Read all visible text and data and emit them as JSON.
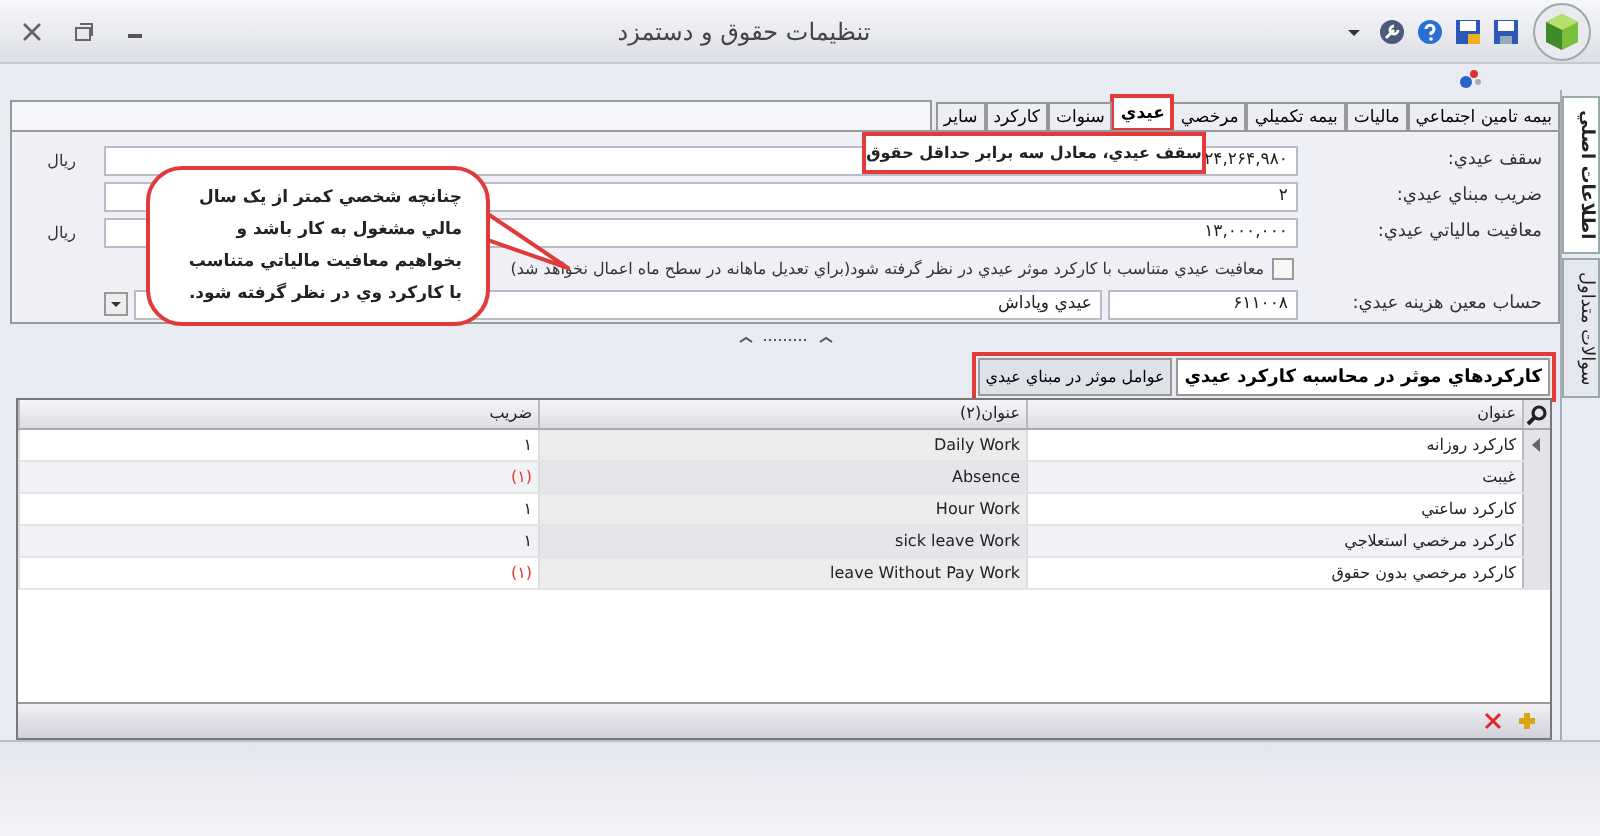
{
  "window": {
    "title": "تنظيمات حقوق و دستمزد"
  },
  "side_tabs": [
    {
      "label": "اطلاعات اصلي",
      "selected": true
    },
    {
      "label": "سوالات متداول",
      "selected": false
    }
  ],
  "tabs": [
    {
      "label": "بيمه تامين اجتماعي",
      "selected": false,
      "highlighted": false
    },
    {
      "label": "ماليات",
      "selected": false,
      "highlighted": false
    },
    {
      "label": "بيمه تكميلي",
      "selected": false,
      "highlighted": false
    },
    {
      "label": "مرخصي",
      "selected": false,
      "highlighted": false
    },
    {
      "label": "عيدي",
      "selected": true,
      "highlighted": true
    },
    {
      "label": "سنوات",
      "selected": false,
      "highlighted": false
    },
    {
      "label": "كاركرد",
      "selected": false,
      "highlighted": false
    },
    {
      "label": "ساير",
      "selected": false,
      "highlighted": false
    }
  ],
  "form": {
    "rows": [
      {
        "kind": "field",
        "label": "سقف عيدي:",
        "value": "۲۴,۲۶۴,۹۸۰",
        "unit": "ريال"
      },
      {
        "kind": "field",
        "label": "ضريب مبناي عيدي:",
        "value": "۲"
      },
      {
        "kind": "field",
        "label": "معافيت مالياتي عيدي:",
        "value": "۱۳,۰۰۰,۰۰۰",
        "unit": "ريال"
      },
      {
        "kind": "checkbox",
        "text": "معافيت عيدي متناسب با كاركرد موثر عيدي در نظر گرفته شود(براي تعديل ماهانه در سطح ماه اعمال نخواهد شد)",
        "checked": false
      },
      {
        "kind": "account",
        "label": "حساب معين هزينه عيدي:",
        "code": "۶۱۱۰۰۸",
        "value": "عيدي وپاداش"
      }
    ]
  },
  "annotations": [
    {
      "kind": "box",
      "text": "سقف عيدي، معادل سه برابر حداقل حقوق"
    },
    {
      "kind": "bubble",
      "text": "چنانچه شخصي كمتر از يک سال مالي مشغول به كار باشد و بخواهيم معافيت مالياتي متناسب با كاركرد وي در نظر گرفته شود."
    }
  ],
  "sub_tabs": {
    "highlighted": true,
    "items": [
      {
        "label": "كاركردهاي موثر در محاسبه كاركرد عيدي",
        "selected": true
      },
      {
        "label": "عوامل موثر در مبناي عيدي",
        "selected": false
      }
    ]
  },
  "table": {
    "columns": [
      "عنوان",
      "عنوان(۲)",
      "ضريب"
    ],
    "rows": [
      {
        "cells": [
          "كاركرد روزانه",
          "Daily Work",
          "۱"
        ],
        "negative": false,
        "selected": true
      },
      {
        "cells": [
          "غيبت",
          "Absence",
          "(۱)"
        ],
        "negative": true,
        "selected": false
      },
      {
        "cells": [
          "كاركرد ساعتي",
          "Hour Work",
          "۱"
        ],
        "negative": false,
        "selected": false
      },
      {
        "cells": [
          "كاركرد مرخصي استعلاجي",
          "sick leave Work",
          "۱"
        ],
        "negative": false,
        "selected": false
      },
      {
        "cells": [
          "كاركرد مرخصي بدون حقوق",
          "leave Without Pay Work",
          "(۱)"
        ],
        "negative": true,
        "selected": false
      }
    ]
  }
}
